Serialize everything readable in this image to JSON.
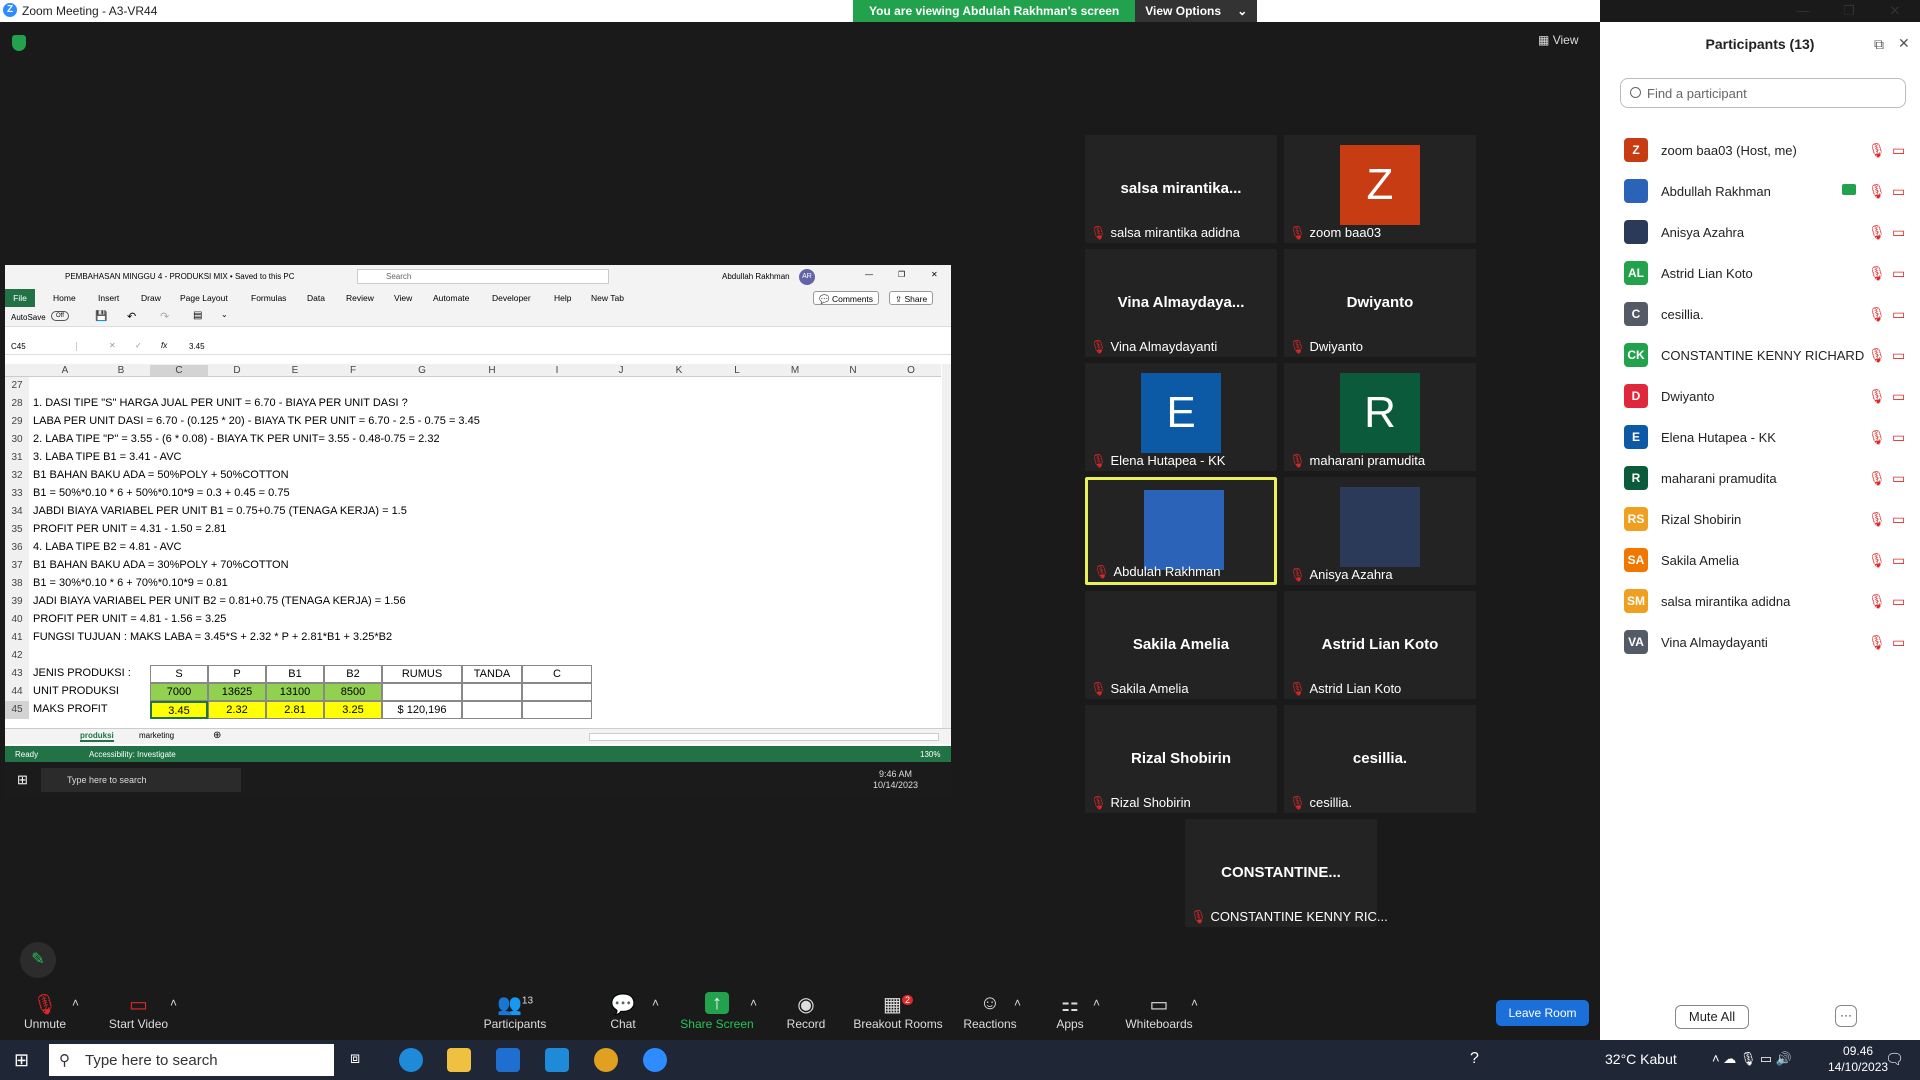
{
  "window": {
    "title": "Zoom Meeting - A3-VR44",
    "logo": "Z"
  },
  "share_banner": {
    "text": "You are viewing Abdulah Rakhman's screen",
    "view_options": "View Options"
  },
  "view_button": "View",
  "excel": {
    "title": "PEMBAHASAN MINGGU 4 - PRODUKSI MIX • Saved to this PC",
    "search": "Search",
    "user": "Abdullah Rakhman",
    "user_initials": "AR",
    "tabs": [
      "File",
      "Home",
      "Insert",
      "Draw",
      "Page Layout",
      "Formulas",
      "Data",
      "Review",
      "View",
      "Automate",
      "Developer",
      "Help",
      "New Tab"
    ],
    "comments": "Comments",
    "share": "Share",
    "autosave": "AutoSave",
    "autosave_state": "Off",
    "name_box": "C45",
    "formula": "3.45",
    "columns": [
      "A",
      "B",
      "C",
      "D",
      "E",
      "F",
      "G",
      "H",
      "I",
      "J",
      "K",
      "L",
      "M",
      "N",
      "O"
    ],
    "lines": [
      {
        "n": "27",
        "t": ""
      },
      {
        "n": "28",
        "t": "1. DASI TIPE \"S\" HARGA JUAL PER UNIT = 6.70 - BIAYA PER UNIT DASI ?"
      },
      {
        "n": "29",
        "t": "    LABA PER UNIT DASI = 6.70 - (0.125 * 20) - BIAYA TK PER UNIT = 6.70 - 2.5 - 0.75  = 3.45"
      },
      {
        "n": "30",
        "t": "2. LABA TIPE \"P\" = 3.55 - (6 * 0.08) - BIAYA TK PER UNIT= 3.55 - 0.48-0.75  = 2.32"
      },
      {
        "n": "31",
        "t": "3. LABA TIPE B1 = 3.41 - AVC"
      },
      {
        "n": "32",
        "t": "    B1 BAHAN BAKU ADA = 50%POLY + 50%COTTON"
      },
      {
        "n": "33",
        "t": "B1  = 50%*0.10 * 6 + 50%*0.10*9 = 0.3 + 0.45 = 0.75"
      },
      {
        "n": "34",
        "t": "   JABDI BIAYA VARIABEL PER UNIT B1 = 0.75+0.75 (TENAGA KERJA) = 1.5"
      },
      {
        "n": "35",
        "t": "   PROFIT PER UNIT = 4.31 - 1.50 = 2.81"
      },
      {
        "n": "36",
        "t": "4. LABA TIPE B2  = 4.81 - AVC"
      },
      {
        "n": "37",
        "t": "    B1 BAHAN BAKU ADA = 30%POLY + 70%COTTON"
      },
      {
        "n": "38",
        "t": "    B1   = 30%*0.10 * 6 + 70%*0.10*9 =                0.81"
      },
      {
        "n": "39",
        "t": "    JADI BIAYA VARIABEL PER UNIT B2 = 0.81+0.75 (TENAGA KERJA) = 1.56"
      },
      {
        "n": "40",
        "t": "    PROFIT PER UNIT = 4.81 - 1.56 = 3.25"
      },
      {
        "n": "41",
        "t": "FUNGSI TUJUAN : MAKS LABA = 3.45*S + 2.32 * P + 2.81*B1 + 3.25*B2"
      },
      {
        "n": "42",
        "t": ""
      }
    ],
    "table": {
      "row43": {
        "n": "43",
        "label": "JENIS PRODUKSI :",
        "cells": [
          "S",
          "P",
          "B1",
          "B2",
          "RUMUS",
          "TANDA",
          "C"
        ]
      },
      "row44": {
        "n": "44",
        "label": "UNIT PRODUKSI",
        "cells": [
          "7000",
          "13625",
          "13100",
          "8500",
          "",
          "",
          ""
        ]
      },
      "row45": {
        "n": "45",
        "label": "MAKS PROFIT",
        "cells": [
          "3.45",
          "2.32",
          "2.81",
          "3.25",
          "$     120,196",
          "",
          ""
        ]
      }
    },
    "sheets": [
      "produksi",
      "marketing"
    ],
    "status_left": "Ready",
    "accessibility": "Accessibility: Investigate",
    "zoom": "130%",
    "inner_search": "Type here to search",
    "inner_time": "9:46 AM",
    "inner_date": "10/14/2023"
  },
  "tiles": [
    {
      "name": "salsa  mirantika...",
      "label": "salsa mirantika adidna",
      "avatar": "",
      "color": ""
    },
    {
      "name": "",
      "label": "zoom baa03",
      "avatar": "Z",
      "color": "#c83c14"
    },
    {
      "name": "Vina  Almaydaya...",
      "label": "Vina Almaydayanti",
      "avatar": "",
      "color": ""
    },
    {
      "name": "Dwiyanto",
      "label": "Dwiyanto",
      "avatar": "",
      "color": ""
    },
    {
      "name": "",
      "label": "Elena Hutapea - KK",
      "avatar": "E",
      "color": "#0c5aa6"
    },
    {
      "name": "",
      "label": "maharani pramudita",
      "avatar": "R",
      "color": "#0b5a3c"
    },
    {
      "name": "",
      "label": "Abdulah Rakhman",
      "avatar": "",
      "color": "#2b63b8"
    },
    {
      "name": "",
      "label": "Anisya Azahra",
      "avatar": "",
      "color": "#2c3a5a"
    },
    {
      "name": "Sakila Amelia",
      "label": "Sakila Amelia",
      "avatar": "",
      "color": ""
    },
    {
      "name": "Astrid Lian Koto",
      "label": "Astrid Lian Koto",
      "avatar": "",
      "color": ""
    },
    {
      "name": "Rizal Shobirin",
      "label": "Rizal Shobirin",
      "avatar": "",
      "color": ""
    },
    {
      "name": "cesillia.",
      "label": "cesillia.",
      "avatar": "",
      "color": ""
    },
    {
      "name": "CONSTANTINE...",
      "label": "CONSTANTINE KENNY RIC...",
      "avatar": "",
      "color": ""
    }
  ],
  "participants": {
    "title": "Participants (13)",
    "search_placeholder": "Find a participant",
    "list": [
      {
        "initials": "Z",
        "name": "zoom baa03 (Host, me)",
        "color": "#c83c14"
      },
      {
        "initials": "",
        "name": "Abdullah Rakhman",
        "color": "#2b63b8"
      },
      {
        "initials": "",
        "name": "Anisya Azahra",
        "color": "#2c3a5a"
      },
      {
        "initials": "AL",
        "name": "Astrid Lian Koto",
        "color": "#23a24d"
      },
      {
        "initials": "C",
        "name": "cesillia.",
        "color": "#555b66"
      },
      {
        "initials": "CK",
        "name": "CONSTANTINE KENNY RICHARD",
        "color": "#23a24d"
      },
      {
        "initials": "D",
        "name": "Dwiyanto",
        "color": "#e0283c"
      },
      {
        "initials": "E",
        "name": "Elena Hutapea - KK",
        "color": "#0c5aa6"
      },
      {
        "initials": "R",
        "name": "maharani pramudita",
        "color": "#0b5a3c"
      },
      {
        "initials": "RS",
        "name": "Rizal Shobirin",
        "color": "#f0a020"
      },
      {
        "initials": "SA",
        "name": "Sakila Amelia",
        "color": "#f07800"
      },
      {
        "initials": "SM",
        "name": "salsa mirantika adidna",
        "color": "#f0a020"
      },
      {
        "initials": "VA",
        "name": "Vina Almaydayanti",
        "color": "#555b66"
      }
    ],
    "mute_all": "Mute All",
    "more": "···"
  },
  "toolbar": {
    "unmute": "Unmute",
    "start_video": "Start Video",
    "participants": "Participants",
    "participants_count": "13",
    "chat": "Chat",
    "share_screen": "Share Screen",
    "record": "Record",
    "breakout": "Breakout Rooms",
    "breakout_badge": "2",
    "reactions": "Reactions",
    "apps": "Apps",
    "whiteboards": "Whiteboards",
    "leave": "Leave Room"
  },
  "taskbar": {
    "search": "Type here to search",
    "weather": "32°C  Kabut",
    "time": "09.46",
    "date": "14/10/2023"
  }
}
